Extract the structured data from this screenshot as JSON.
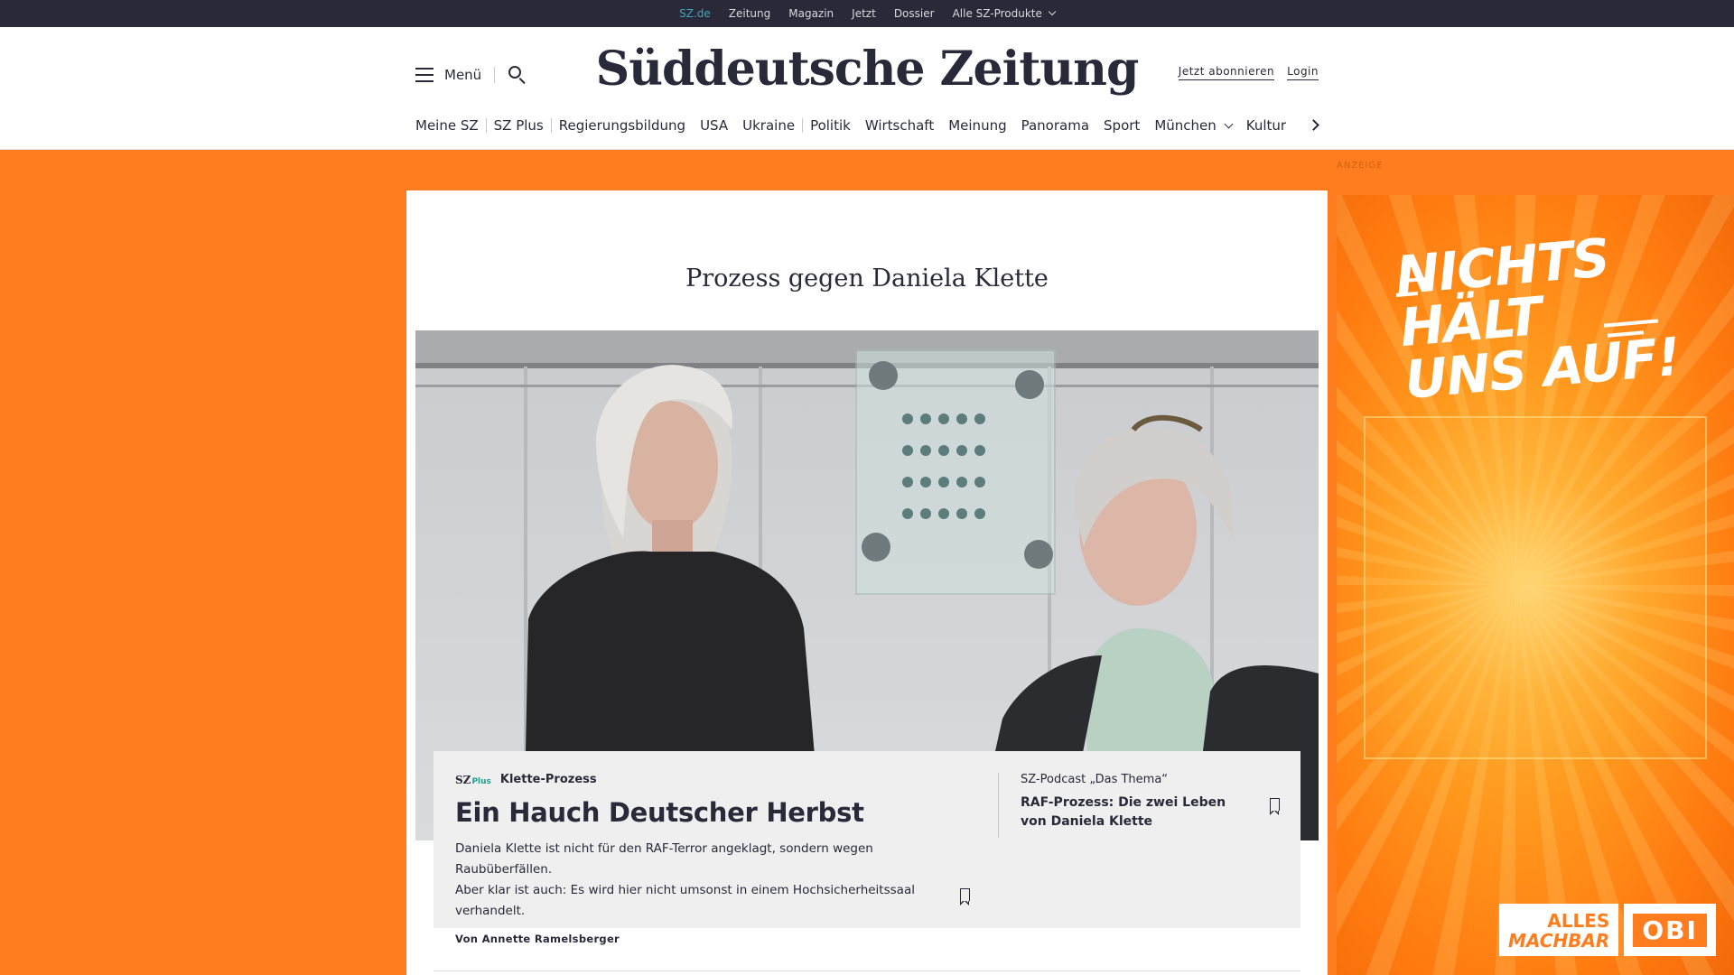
{
  "topbar": {
    "items": [
      "SZ.de",
      "Zeitung",
      "Magazin",
      "Jetzt",
      "Dossier",
      "Alle SZ-Produkte"
    ]
  },
  "header": {
    "menu_label": "Menü",
    "logo": "Süddeutsche Zeitung",
    "subscribe_label": "Jetzt abonnieren",
    "login_label": "Login"
  },
  "nav": {
    "items": [
      "Meine SZ",
      "SZ Plus",
      "Regierungsbildung",
      "USA",
      "Ukraine",
      "Politik",
      "Wirtschaft",
      "Meinung",
      "Panorama",
      "Sport",
      "München",
      "Kultur"
    ]
  },
  "ad_label": "ANZEIGE",
  "dossier": {
    "title": "Prozess gegen Daniela Klette"
  },
  "lead_article": {
    "brand": "SZ",
    "brand_plus": "Plus",
    "kicker": "Klette-Prozess",
    "headline": "Ein Hauch Deutscher Herbst",
    "teaser_line1": "Daniela Klette ist nicht für den RAF-Terror angeklagt, sondern wegen Raubüberfällen.",
    "teaser_line2": "Aber klar ist auch: Es wird hier nicht umsonst in einem Hochsicherheitssaal verhandelt.",
    "author": "Von Annette Ramelsberger"
  },
  "side_article": {
    "kicker": "SZ-Podcast „Das Thema“",
    "title": "RAF-Prozess: Die zwei Leben von Daniela Klette"
  },
  "ad": {
    "headline_line1": "NICHTS HÄLT",
    "headline_line2": "UNS AUF!",
    "brand_line1": "ALLES",
    "brand_line2": "MACHBAR",
    "brand_logo": "OBI"
  },
  "colors": {
    "page_background": "#ff7d1e",
    "topbar": "#29293a",
    "active_link": "#3fa6b4",
    "sz_plus": "#1ea08c",
    "card_background": "#efeff0"
  }
}
